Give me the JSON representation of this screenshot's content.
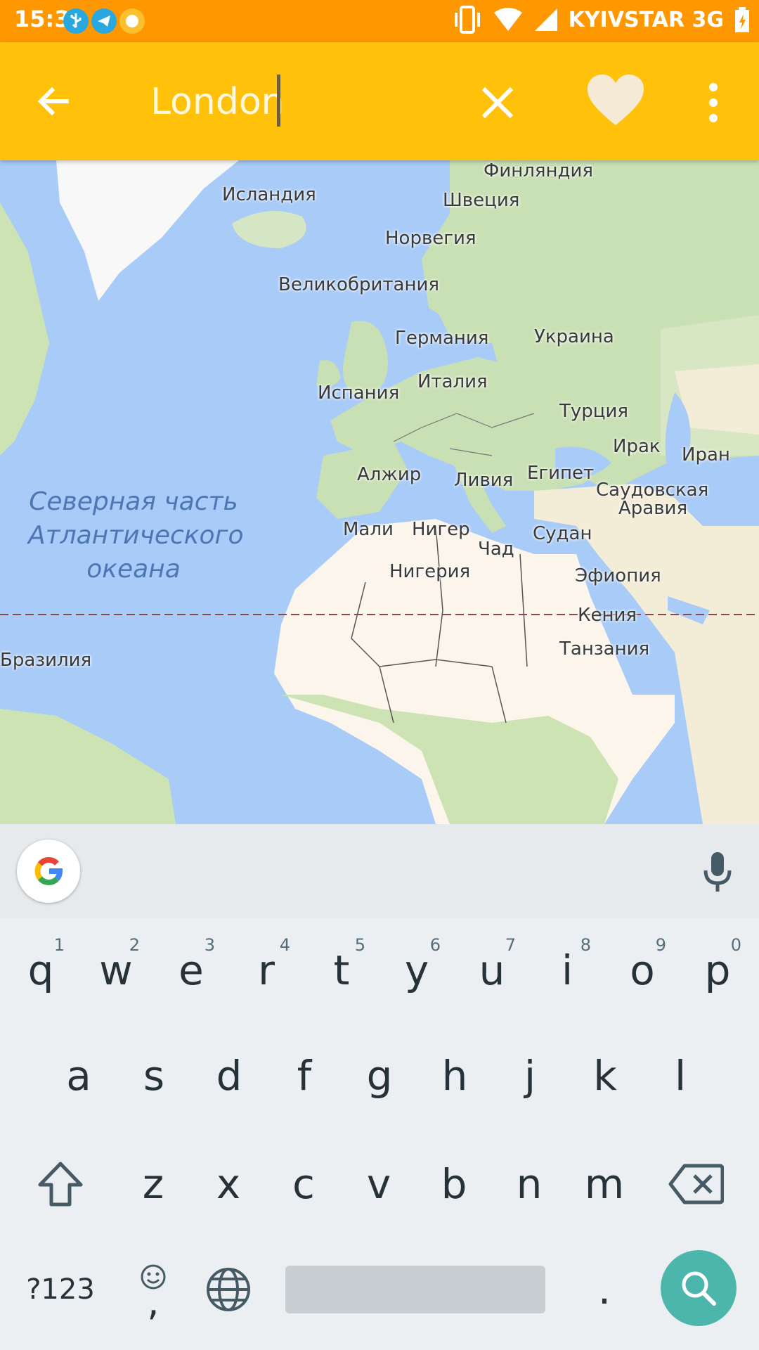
{
  "status_bar": {
    "time": "15:33",
    "carrier": "KYIVSTAR 3G"
  },
  "search": {
    "query": "London",
    "placeholder": ""
  },
  "map": {
    "ocean_lines": [
      "Северная часть",
      "Атлантического",
      "океана"
    ],
    "labels": [
      {
        "name": "Финляндия"
      },
      {
        "name": "Исландия"
      },
      {
        "name": "Швеция"
      },
      {
        "name": "Норвегия"
      },
      {
        "name": "Великобритания"
      },
      {
        "name": "Германия"
      },
      {
        "name": "Украина"
      },
      {
        "name": "Испания"
      },
      {
        "name": "Италия"
      },
      {
        "name": "Турция"
      },
      {
        "name": "Ирак"
      },
      {
        "name": "Иран"
      },
      {
        "name": "Алжир"
      },
      {
        "name": "Ливия"
      },
      {
        "name": "Египет"
      },
      {
        "name": "Саудовская"
      },
      {
        "name": "Аравия"
      },
      {
        "name": "Мали"
      },
      {
        "name": "Нигер"
      },
      {
        "name": "Чад"
      },
      {
        "name": "Судан"
      },
      {
        "name": "Нигерия"
      },
      {
        "name": "Эфиопия"
      },
      {
        "name": "Кения"
      },
      {
        "name": "Танзания"
      },
      {
        "name": "Бразилия"
      }
    ]
  },
  "keyboard": {
    "row1": [
      {
        "key": "q",
        "hint": "1"
      },
      {
        "key": "w",
        "hint": "2"
      },
      {
        "key": "e",
        "hint": "3"
      },
      {
        "key": "r",
        "hint": "4"
      },
      {
        "key": "t",
        "hint": "5"
      },
      {
        "key": "y",
        "hint": "6"
      },
      {
        "key": "u",
        "hint": "7"
      },
      {
        "key": "i",
        "hint": "8"
      },
      {
        "key": "o",
        "hint": "9"
      },
      {
        "key": "p",
        "hint": "0"
      }
    ],
    "row2": [
      "a",
      "s",
      "d",
      "f",
      "g",
      "h",
      "j",
      "k",
      "l"
    ],
    "row3": [
      "z",
      "x",
      "c",
      "v",
      "b",
      "n",
      "m"
    ],
    "symbols_label": "?123",
    "comma_label": ",",
    "period_label": "."
  },
  "colors": {
    "status_bar": "#ff9800",
    "app_bar": "#ffc10a",
    "search_fab": "#4db6ac",
    "water": "#a8cbf7"
  }
}
